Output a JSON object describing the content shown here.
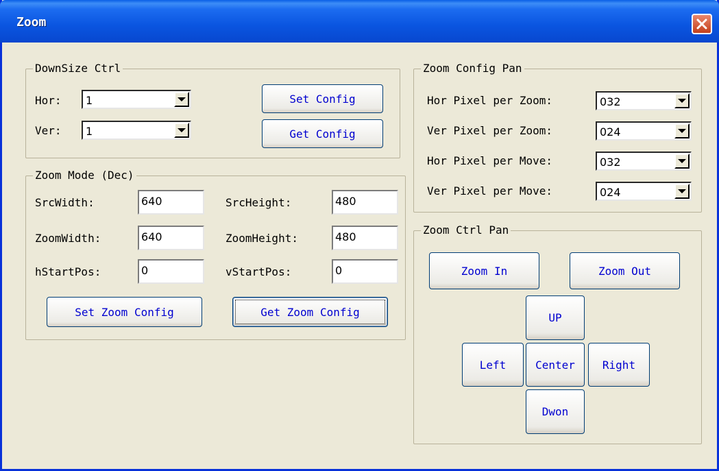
{
  "window": {
    "title": "Zoom"
  },
  "downsize": {
    "legend": "DownSize Ctrl",
    "hor_label": "Hor:",
    "hor_value": "1",
    "ver_label": "Ver:",
    "ver_value": "1",
    "set_config": "Set Config",
    "get_config": "Get Config"
  },
  "zoom_mode": {
    "legend": "Zoom Mode (Dec)",
    "src_width_label": "SrcWidth:",
    "src_width": "640",
    "src_height_label": "SrcHeight:",
    "src_height": "480",
    "zoom_width_label": "ZoomWidth:",
    "zoom_width": "640",
    "zoom_height_label": "ZoomHeight:",
    "zoom_height": "480",
    "hstart_label": "hStartPos:",
    "hstart": "0",
    "vstart_label": "vStartPos:",
    "vstart": "0",
    "set_button": "Set Zoom Config",
    "get_button": "Get Zoom Config"
  },
  "zoom_config": {
    "legend": "Zoom Config Pan",
    "hor_zoom_label": "Hor Pixel per Zoom:",
    "hor_zoom": "032",
    "ver_zoom_label": "Ver Pixel per Zoom:",
    "ver_zoom": "024",
    "hor_move_label": "Hor Pixel per Move:",
    "hor_move": "032",
    "ver_move_label": "Ver Pixel per Move:",
    "ver_move": "024"
  },
  "zoom_ctrl": {
    "legend": "Zoom Ctrl Pan",
    "zoom_in": "Zoom In",
    "zoom_out": "Zoom Out",
    "up": "UP",
    "left": "Left",
    "center": "Center",
    "right": "Right",
    "down": "Dwon"
  },
  "icons": {
    "close": "close-icon",
    "dropdown": "chevron-down-icon"
  },
  "colors": {
    "titlebar": "#0a55e0",
    "button_text": "#0000d0",
    "close": "#c4401b"
  }
}
